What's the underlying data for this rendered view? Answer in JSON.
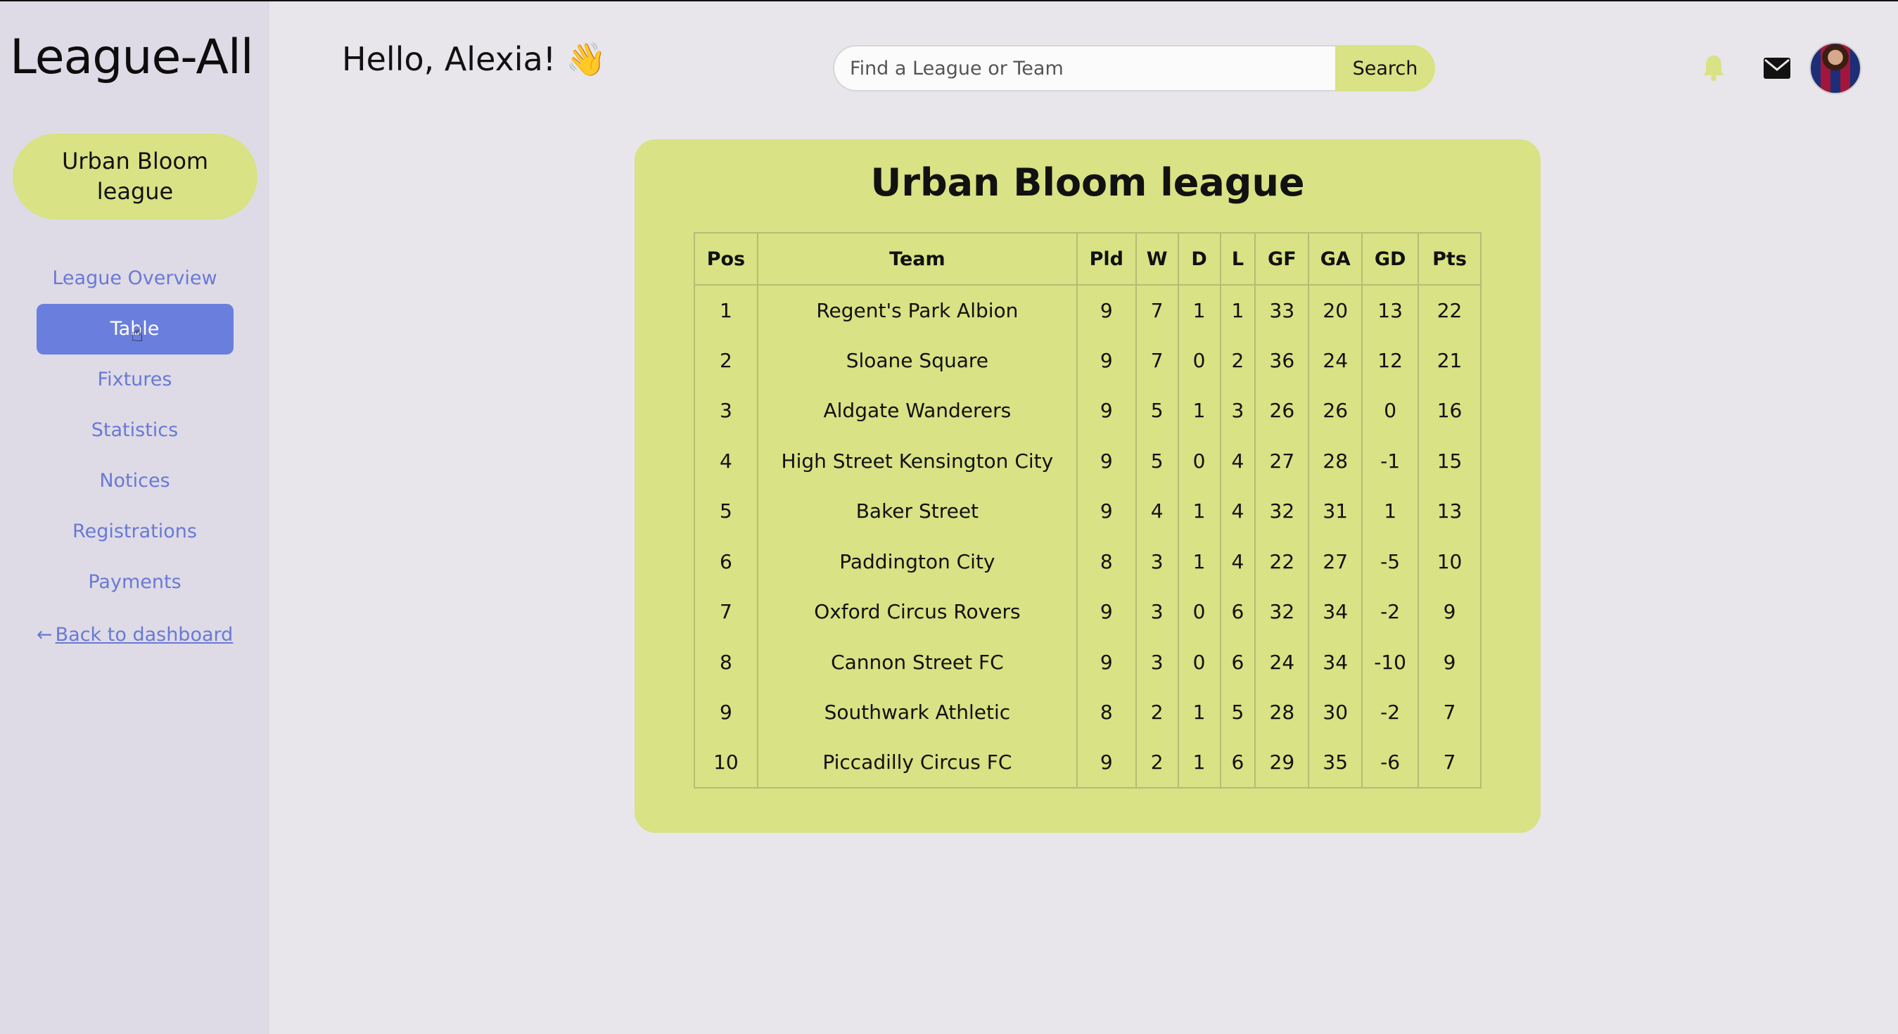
{
  "app": {
    "logo": "League-All",
    "greeting": "Hello, Alexia! 👋"
  },
  "sidebar": {
    "league_name": "Urban Bloom league",
    "items": [
      {
        "label": "League Overview"
      },
      {
        "label": "Table"
      },
      {
        "label": "Fixtures"
      },
      {
        "label": "Statistics"
      },
      {
        "label": "Notices"
      },
      {
        "label": "Registrations"
      },
      {
        "label": "Payments"
      }
    ],
    "active_item": "Table",
    "back_link": "Back to dashboard"
  },
  "header": {
    "search_placeholder": "Find a League or Team",
    "search_value": "",
    "search_button": "Search",
    "icons": [
      "bell-icon",
      "mail-icon",
      "avatar"
    ]
  },
  "table_card": {
    "title": "Urban Bloom league",
    "columns": [
      "Pos",
      "Team",
      "Pld",
      "W",
      "D",
      "L",
      "GF",
      "GA",
      "GD",
      "Pts"
    ],
    "rows": [
      [
        "1",
        "Regent's Park Albion",
        "9",
        "7",
        "1",
        "1",
        "33",
        "20",
        "13",
        "22"
      ],
      [
        "2",
        "Sloane Square",
        "9",
        "7",
        "0",
        "2",
        "36",
        "24",
        "12",
        "21"
      ],
      [
        "3",
        "Aldgate Wanderers",
        "9",
        "5",
        "1",
        "3",
        "26",
        "26",
        "0",
        "16"
      ],
      [
        "4",
        "High Street Kensington City",
        "9",
        "5",
        "0",
        "4",
        "27",
        "28",
        "-1",
        "15"
      ],
      [
        "5",
        "Baker Street",
        "9",
        "4",
        "1",
        "4",
        "32",
        "31",
        "1",
        "13"
      ],
      [
        "6",
        "Paddington City",
        "8",
        "3",
        "1",
        "4",
        "22",
        "27",
        "-5",
        "10"
      ],
      [
        "7",
        "Oxford Circus Rovers",
        "9",
        "3",
        "0",
        "6",
        "32",
        "34",
        "-2",
        "9"
      ],
      [
        "8",
        "Cannon Street FC",
        "9",
        "3",
        "0",
        "6",
        "24",
        "34",
        "-10",
        "9"
      ],
      [
        "9",
        "Southwark Athletic",
        "8",
        "2",
        "1",
        "5",
        "28",
        "30",
        "-2",
        "7"
      ],
      [
        "10",
        "Piccadilly Circus FC",
        "9",
        "2",
        "1",
        "6",
        "29",
        "35",
        "-6",
        "7"
      ]
    ]
  },
  "colors": {
    "accent_yellow": "#d9e284",
    "nav_blue": "#6a79d3",
    "active_blue": "#6a7fdd",
    "sidebar_bg": "#dedbe7",
    "page_bg": "#e8e6ea"
  }
}
